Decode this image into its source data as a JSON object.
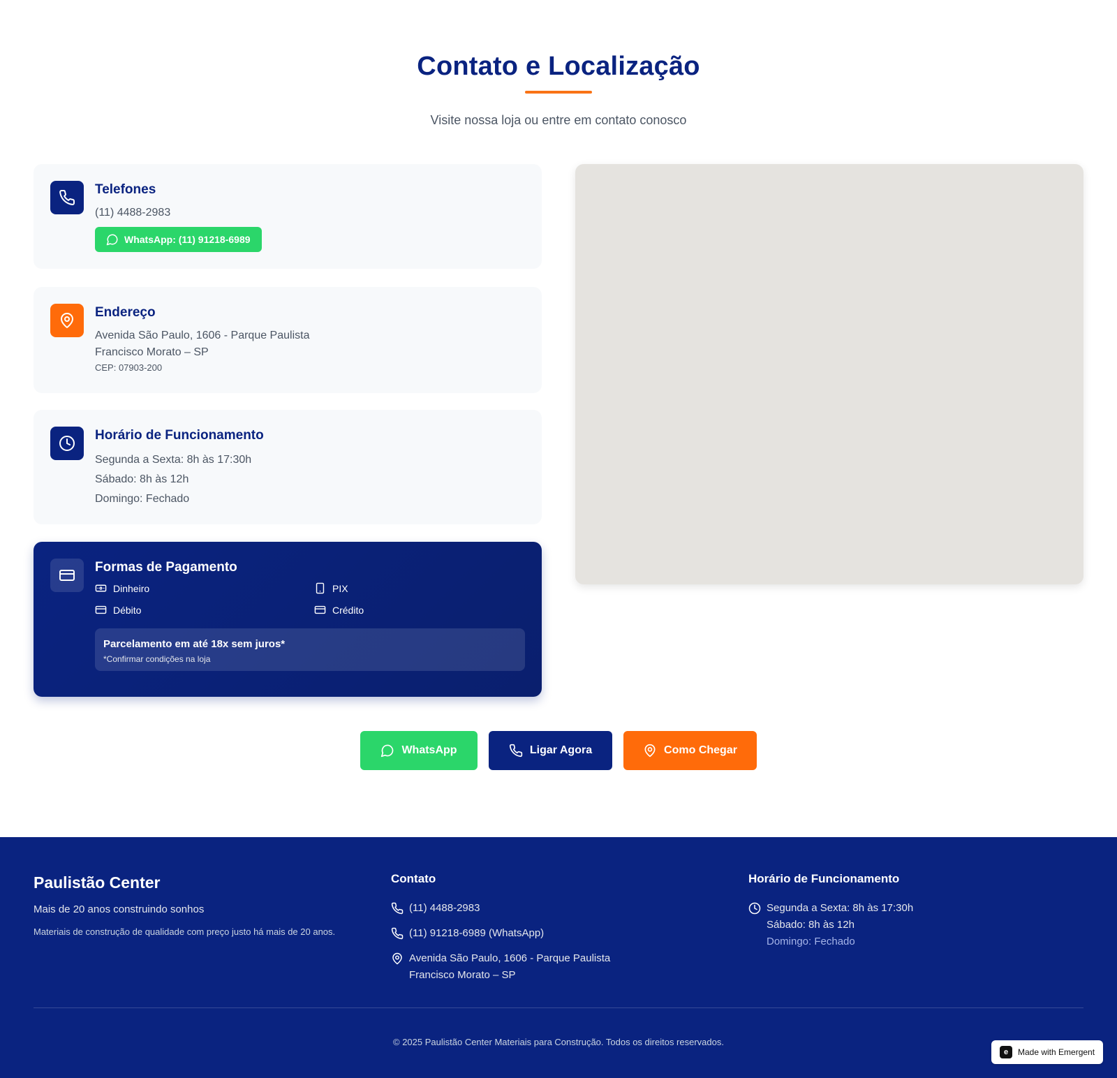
{
  "header": {
    "title": "Contato e Localização",
    "subtitle": "Visite nossa loja ou entre em contato conosco"
  },
  "phones": {
    "title": "Telefones",
    "landline": "(11) 4488-2983",
    "whatsapp_label": "WhatsApp: (11) 91218-6989",
    "icon": "phone-icon"
  },
  "address": {
    "title": "Endereço",
    "line1": "Avenida São Paulo, 1606 - Parque Paulista",
    "line2": "Francisco Morato – SP",
    "cep": "CEP: 07903-200",
    "icon": "map-pin-icon"
  },
  "hours": {
    "title": "Horário de Funcionamento",
    "weekdays": "Segunda a Sexta: 8h às 17:30h",
    "saturday": "Sábado: 8h às 12h",
    "sunday": "Domingo: Fechado",
    "icon": "clock-icon"
  },
  "payment": {
    "title": "Formas de Pagamento",
    "methods": [
      {
        "label": "Dinheiro",
        "icon": "cash-icon"
      },
      {
        "label": "PIX",
        "icon": "smartphone-icon"
      },
      {
        "label": "Débito",
        "icon": "credit-card-icon"
      },
      {
        "label": "Crédito",
        "icon": "credit-card-icon"
      }
    ],
    "installments_title": "Parcelamento em até 18x sem juros*",
    "installments_note": "*Confirmar condições na loja"
  },
  "cta": {
    "whatsapp": "WhatsApp",
    "call": "Ligar Agora",
    "directions": "Como Chegar"
  },
  "footer": {
    "brand": "Paulistão Center",
    "tagline": "Mais de 20 anos construindo sonhos",
    "description": "Materiais de construção de qualidade com preço justo há mais de 20 anos.",
    "contact_title": "Contato",
    "phone": "(11) 4488-2983",
    "whatsapp": "(11) 91218-6989 (WhatsApp)",
    "address_line1": "Avenida São Paulo, 1606 - Parque Paulista",
    "address_line2": "Francisco Morato – SP",
    "hours_title": "Horário de Funcionamento",
    "hours_weekdays": "Segunda a Sexta: 8h às 17:30h",
    "hours_saturday": "Sábado: 8h às 12h",
    "hours_sunday": "Domingo: Fechado",
    "copyright": "© 2025 Paulistão Center Materiais para Construção. Todos os direitos reservados."
  },
  "badge": {
    "label": "Made with Emergent"
  },
  "colors": {
    "navy": "#0a2380",
    "orange": "#ff6b0a",
    "whatsapp_green": "#2bd66a",
    "card_bg": "#f7f9fb",
    "map_bg": "#e5e3df"
  }
}
